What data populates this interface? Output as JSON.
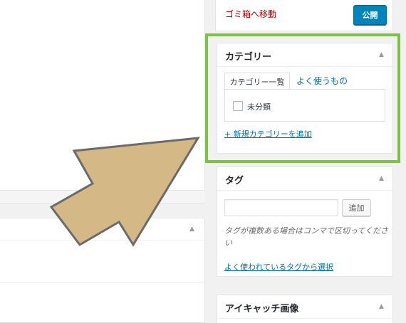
{
  "publish": {
    "trash_label": "ゴミ箱へ移動",
    "publish_label": "公開"
  },
  "categories": {
    "title": "カテゴリー",
    "tab_all": "カテゴリー一覧",
    "tab_popular": "よく使うもの",
    "items": [
      {
        "label": "未分類",
        "checked": false
      }
    ],
    "add_new_label": "+ 新規カテゴリーを追加"
  },
  "tags": {
    "title": "タグ",
    "input_value": "",
    "add_button_label": "追加",
    "hint": "タグが複数ある場合はコンマで区切ってください",
    "choose_label": "よく使われているタグから選択"
  },
  "featured_image": {
    "title": "アイキャッチ画像"
  },
  "toggle_glyph": "▲",
  "colors": {
    "highlight_frame": "#7cc243",
    "arrow_fill": "#d4b886",
    "arrow_stroke": "#6b6b6b",
    "link": "#0073aa",
    "trash": "#aa0000",
    "primary_button": "#0085ba"
  }
}
